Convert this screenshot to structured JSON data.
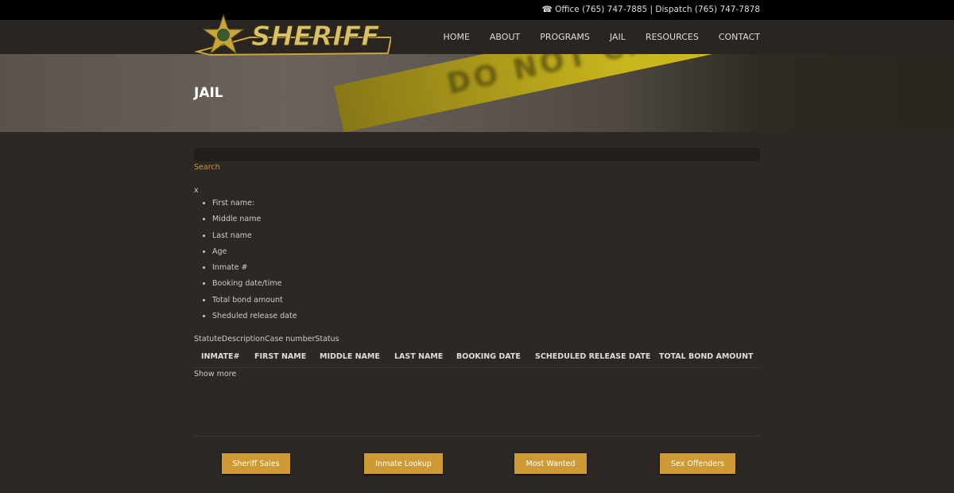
{
  "topbar": {
    "contact": "Office (765) 747-7885 | Dispatch (765) 747-7878",
    "phone_icon": "phone-icon"
  },
  "logo": {
    "text": "SHERIFF"
  },
  "nav": {
    "items": [
      "HOME",
      "ABOUT",
      "PROGRAMS",
      "JAIL",
      "RESOURCES",
      "CONTACT"
    ]
  },
  "banner": {
    "title": "JAIL",
    "tape_text": "DO NOT CROSS  SHERIFF LINE DO"
  },
  "search": {
    "value": "",
    "label": "Search"
  },
  "detail": {
    "close": "x",
    "fields": [
      "First name:",
      "Middle name",
      "Last name",
      "Age",
      "Inmate #",
      "Booking date/time",
      "Total bond amount",
      "Sheduled release date"
    ],
    "charges_header": "StatuteDescriptionCase numberStatus"
  },
  "table": {
    "headers": [
      "INMATE#",
      "FIRST NAME",
      "MIDDLE NAME",
      "LAST NAME",
      "BOOKING DATE",
      "SCHEDULED RELEASE DATE",
      "TOTAL BOND AMOUNT"
    ],
    "show_more": "Show more"
  },
  "footer_buttons": [
    "Sheriff Sales",
    "Inmate Lookup",
    "Most Wanted",
    "Sex Offenders"
  ],
  "colors": {
    "accent": "#cd9a35",
    "background": "#2d2824"
  }
}
